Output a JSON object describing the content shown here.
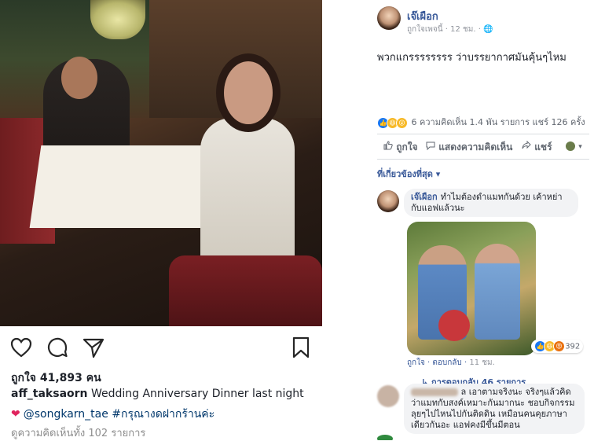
{
  "instagram": {
    "likes": "ถูกใจ 41,893 คน",
    "username": "aff_taksaorn",
    "caption": " Wedding Anniversary Dinner last night",
    "heart": "❤",
    "caption_line2": "@songkarn_tae #กรุณางดฝากร้านค่ะ",
    "view_comments": "ดูความคิดเห็นทั้ง 102 รายการ",
    "icons": [
      "heart-icon",
      "comment-icon",
      "share-icon",
      "bookmark-icon"
    ]
  },
  "facebook": {
    "page_name": "เจ๊เผือก",
    "meta": "ถูกใจเพจนี้ · 12 ชม. · 🌐",
    "post_text": "พวกแกรรรรรรรร ว่าบรรยากาศมันคุ้นๆไหม",
    "reactions_summary": "6 ความคิดเห็น 1.4 พัน รายการ  แชร์ 126 ครั้ง",
    "actions": {
      "like": "ถูกใจ",
      "comment": "แสดงความคิดเห็น",
      "share": "แชร์"
    },
    "relevance_filter": "ที่เกี่ยวข้องที่สุด ▾",
    "comment1": {
      "name": "เจ๊เผือก",
      "text": "ทำไมต้องดำแมทกันด้วย เค้าหย่ากับแอฟแล้วนะ",
      "reaction_count": "392",
      "like_label": "ถูกใจ",
      "reply_label": "ตอบกลับ",
      "time": "11 ชม.",
      "replies": "↳ การตอบกลับ 46 รายการ"
    },
    "comment2": {
      "text": "ล เอาตามจริงนะ จริงๆแล้วคิดว่าแมทกับสงค์เหมาะกันมากนะ ชอบกิจกรรมลุยๆไปไหนไปกันติดดิน เหมือนคนคุยภาษาเดียวกันอะ แอฟคงมีขึ้นมีตอน"
    },
    "colors": {
      "link": "#385898",
      "muted": "#90949c",
      "bubble": "#f2f3f5"
    }
  }
}
